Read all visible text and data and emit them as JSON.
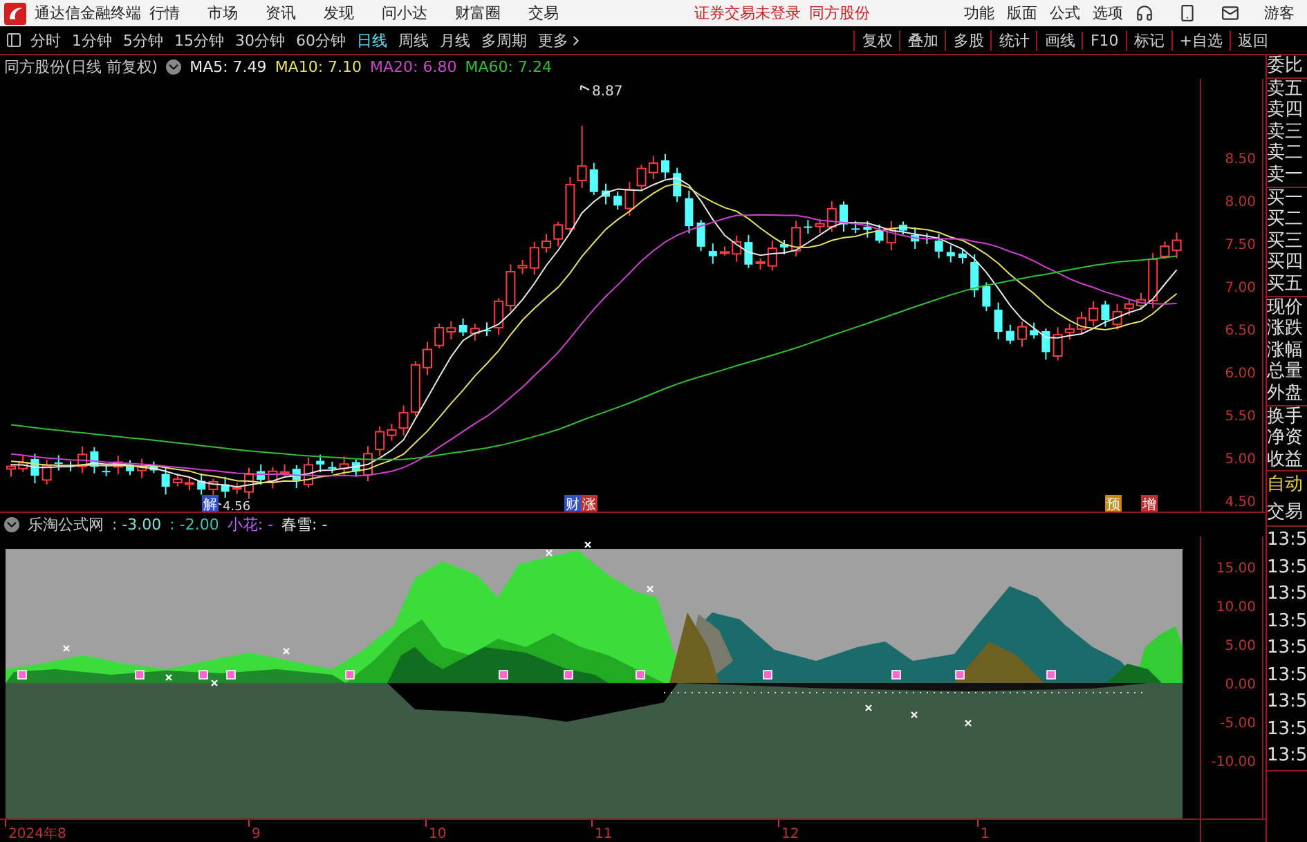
{
  "app": {
    "title": "通达信金融终端"
  },
  "menu": [
    "行情",
    "市场",
    "资讯",
    "发现",
    "问小达",
    "财富圈",
    "交易"
  ],
  "notice": {
    "login": "证券交易未登录",
    "stock": "同方股份"
  },
  "right_menu": [
    "功能",
    "版面",
    "公式",
    "选项"
  ],
  "user": "游客",
  "periods": [
    {
      "label": "分时",
      "selected": false
    },
    {
      "label": "1分钟",
      "selected": false
    },
    {
      "label": "5分钟",
      "selected": false
    },
    {
      "label": "15分钟",
      "selected": false
    },
    {
      "label": "30分钟",
      "selected": false
    },
    {
      "label": "60分钟",
      "selected": false
    },
    {
      "label": "日线",
      "selected": true
    },
    {
      "label": "周线",
      "selected": false
    },
    {
      "label": "月线",
      "selected": false
    },
    {
      "label": "多周期",
      "selected": false
    },
    {
      "label": "更多",
      "selected": false
    }
  ],
  "toolbar_buttons": [
    "复权",
    "叠加",
    "多股",
    "统计",
    "画线",
    "F10",
    "标记",
    "+自选",
    "返回"
  ],
  "main_chart": {
    "title": "同方股份(日线 前复权)",
    "ma": [
      {
        "label": "MA5: 7.49",
        "color": "#e8e8e8"
      },
      {
        "label": "MA10: 7.10",
        "color": "#e8e060"
      },
      {
        "label": "MA20: 6.80",
        "color": "#d040d0"
      },
      {
        "label": "MA60: 7.24",
        "color": "#30c030"
      }
    ],
    "price_axis": [
      "8.50",
      "8.00",
      "7.50",
      "7.00",
      "6.50",
      "6.00",
      "5.50",
      "5.00",
      "4.50"
    ],
    "high_label": "8.87",
    "low_label": "4.56",
    "event_marks": [
      {
        "text": "解",
        "color": "#3050c8"
      },
      {
        "text": "财",
        "color": "#3050c8"
      },
      {
        "text": "涨",
        "color": "#c03030"
      },
      {
        "text": "预",
        "color": "#c88a10"
      },
      {
        "text": "增",
        "color": "#c03030"
      }
    ]
  },
  "indicator": {
    "name": "乐淘公式网",
    "values": [
      {
        "text": ": -3.00",
        "color": "#80e0d0"
      },
      {
        "text": ": -2.00",
        "color": "#40c0b0"
      },
      {
        "text": "小花: -",
        "color": "#c060ff"
      },
      {
        "text": "春雪: -",
        "color": "#e8e8e8"
      }
    ],
    "axis": [
      "15.00",
      "10.00",
      "5.00",
      "0.00",
      "-5.00",
      "-10.00"
    ]
  },
  "date_axis": [
    "2024年8",
    "9",
    "10",
    "11",
    "12",
    "1"
  ],
  "quote_panel": [
    [
      {
        "text": "委比",
        "kind": "label"
      }
    ],
    [
      {
        "text": "卖五",
        "kind": "label"
      },
      {
        "text": "卖四",
        "kind": "label"
      },
      {
        "text": "卖三",
        "kind": "label"
      },
      {
        "text": "卖二",
        "kind": "label"
      },
      {
        "text": "卖一",
        "kind": "label"
      }
    ],
    [
      {
        "text": "买一",
        "kind": "label"
      },
      {
        "text": "买二",
        "kind": "label"
      },
      {
        "text": "买三",
        "kind": "label"
      },
      {
        "text": "买四",
        "kind": "label"
      },
      {
        "text": "买五",
        "kind": "label"
      }
    ],
    [
      {
        "text": "现价",
        "kind": "label"
      },
      {
        "text": "涨跌",
        "kind": "label"
      },
      {
        "text": "涨幅",
        "kind": "label"
      },
      {
        "text": "总量",
        "kind": "label"
      },
      {
        "text": "外盘",
        "kind": "label"
      }
    ],
    [
      {
        "text": "换手",
        "kind": "label"
      },
      {
        "text": "净资",
        "kind": "label"
      },
      {
        "text": "收益",
        "kind": "label"
      }
    ],
    [
      {
        "text": "自动",
        "kind": "action"
      },
      {
        "text": "交易",
        "kind": "label"
      }
    ],
    [
      {
        "text": "13:5",
        "kind": "time"
      },
      {
        "text": "13:5",
        "kind": "time"
      },
      {
        "text": "13:5",
        "kind": "time"
      },
      {
        "text": "13:5",
        "kind": "time"
      },
      {
        "text": "13:5",
        "kind": "time"
      },
      {
        "text": "13:5",
        "kind": "time"
      },
      {
        "text": "13:5",
        "kind": "time"
      },
      {
        "text": "13:5",
        "kind": "time"
      },
      {
        "text": "13:5",
        "kind": "time"
      }
    ]
  ]
}
